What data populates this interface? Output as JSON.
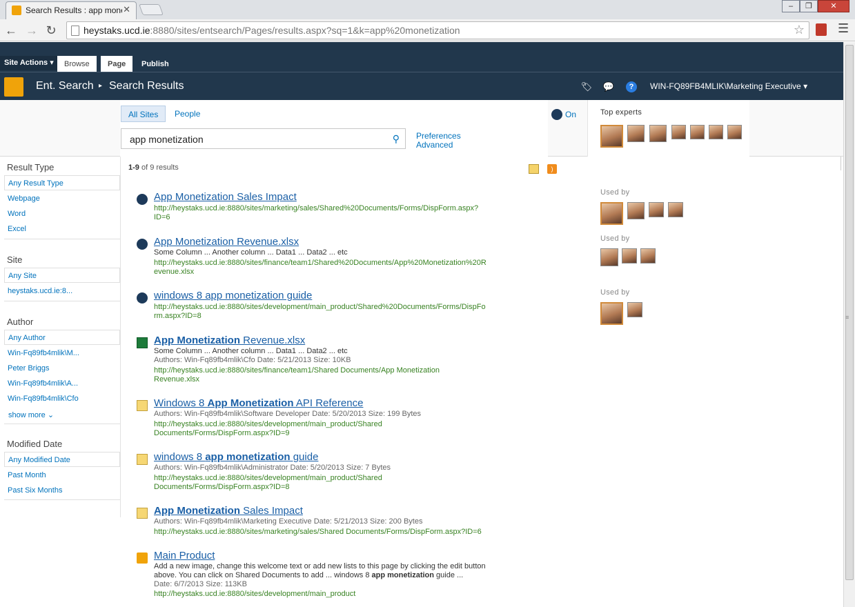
{
  "browser": {
    "tab_title": "Search Results : app mone",
    "url_host": "heystaks.ucd.ie",
    "url_rest": ":8880/sites/entsearch/Pages/results.aspx?sq=1&k=app%20monetization"
  },
  "ribbon": {
    "site_actions": "Site Actions",
    "tabs": [
      "Browse",
      "Page",
      "Publish"
    ]
  },
  "titlebar": {
    "site": "Ent. Search",
    "page": "Search Results",
    "user": "WIN-FQ89FB4MLIK\\Marketing Executive"
  },
  "search": {
    "scopes": [
      "All Sites",
      "People"
    ],
    "query": "app monetization",
    "links": [
      "Preferences",
      "Advanced"
    ],
    "toggle_label": "On",
    "experts_title": "Top experts"
  },
  "refiners": {
    "result_type": {
      "title": "Result Type",
      "selected": "Any Result Type",
      "items": [
        "Webpage",
        "Word",
        "Excel"
      ]
    },
    "site": {
      "title": "Site",
      "selected": "Any Site",
      "items": [
        "heystaks.ucd.ie:8..."
      ]
    },
    "author": {
      "title": "Author",
      "selected": "Any Author",
      "items": [
        "Win-Fq89fb4mlik\\M...",
        "Peter Briggs",
        "Win-Fq89fb4mlik\\A...",
        "Win-Fq89fb4mlik\\Cfo"
      ],
      "more": "show more"
    },
    "modified": {
      "title": "Modified Date",
      "selected": "Any Modified Date",
      "items": [
        "Past Month",
        "Past Six Months"
      ]
    }
  },
  "results_summary": {
    "range": "1-9",
    "rest": " of 9 results"
  },
  "results": [
    {
      "title": "App Monetization Sales Impact",
      "url1": "http://heystaks.ucd.ie:8880/sites/marketing/sales/Shared%20Documents/Forms/DispForm.aspx?",
      "url2": "ID=6"
    },
    {
      "title": "App Monetization Revenue.xlsx",
      "snippet": "Some Column ... Another column ... Data1 ... Data2 ... etc",
      "url1": "http://heystaks.ucd.ie:8880/sites/finance/team1/Shared%20Documents/App%20Monetization%20R",
      "url2": "evenue.xlsx"
    },
    {
      "title": "windows 8 app monetization guide",
      "url1": "http://heystaks.ucd.ie:8880/sites/development/main_product/Shared%20Documents/Forms/DispFo",
      "url2": "rm.aspx?ID=8"
    },
    {
      "title_bold": "App Monetization",
      "title_rest": " Revenue.xlsx",
      "snippet": "Some Column ... Another column ... Data1 ... Data2 ... etc",
      "meta": "Authors: Win-Fq89fb4mlik\\Cfo   Date: 5/21/2013   Size: 10KB",
      "url1": "http://heystaks.ucd.ie:8880/sites/finance/team1/Shared Documents/App Monetization",
      "url2": "Revenue.xlsx"
    },
    {
      "title_pre": "Windows 8 ",
      "title_bold": "App Monetization",
      "title_rest": " API Reference",
      "meta": "Authors: Win-Fq89fb4mlik\\Software Developer   Date: 5/20/2013   Size: 199 Bytes",
      "url1": "http://heystaks.ucd.ie:8880/sites/development/main_product/Shared",
      "url2": "Documents/Forms/DispForm.aspx?ID=9"
    },
    {
      "title_pre": "windows 8 ",
      "title_bold": "app monetization",
      "title_rest": " guide",
      "meta": "Authors: Win-Fq89fb4mlik\\Administrator   Date: 5/20/2013   Size: 7 Bytes",
      "url1": "http://heystaks.ucd.ie:8880/sites/development/main_product/Shared",
      "url2": "Documents/Forms/DispForm.aspx?ID=8"
    },
    {
      "title_bold": "App Monetization",
      "title_rest": " Sales Impact",
      "meta": "Authors: Win-Fq89fb4mlik\\Marketing Executive   Date: 5/21/2013   Size: 200 Bytes",
      "url1": "http://heystaks.ucd.ie:8880/sites/marketing/sales/Shared Documents/Forms/DispForm.aspx?ID=6"
    },
    {
      "title": "Main Product",
      "snippet1": "Add a new image, change this welcome text or add new lists to this page by clicking the edit button",
      "snippet2_pre": "above. You can click on Shared Documents to add ... windows 8 ",
      "snippet2_bold": "app monetization",
      "snippet2_rest": " guide ...",
      "meta": "Date: 6/7/2013   Size: 113KB",
      "url1": "http://heystaks.ucd.ie:8880/sites/development/main_product"
    }
  ],
  "used_by_label": "Used by",
  "colors": {
    "ribbon": "#21374c",
    "link": "#1a5fa6",
    "url_green": "#388222",
    "accent_orange": "#f0a30a"
  }
}
